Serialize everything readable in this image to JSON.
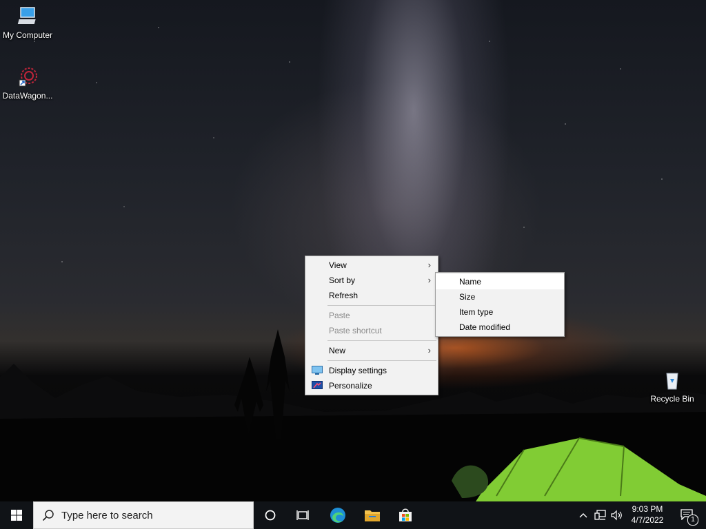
{
  "desktop": {
    "icons": [
      {
        "name": "My Computer",
        "icon": "computer-icon"
      },
      {
        "name": "DataWagon...",
        "icon": "datawagon-shortcut-icon"
      },
      {
        "name": "Recycle Bin",
        "icon": "recycle-bin-icon"
      }
    ]
  },
  "context_menu": {
    "items": [
      {
        "label": "View",
        "has_submenu": true
      },
      {
        "label": "Sort by",
        "has_submenu": true
      },
      {
        "label": "Refresh"
      },
      {
        "label": "Paste",
        "disabled": true
      },
      {
        "label": "Paste shortcut",
        "disabled": true
      },
      {
        "label": "New",
        "has_submenu": true
      },
      {
        "label": "Display settings",
        "icon": "display-settings-icon"
      },
      {
        "label": "Personalize",
        "icon": "personalize-icon"
      }
    ]
  },
  "sort_submenu": {
    "items": [
      {
        "label": "Name",
        "highlighted": true
      },
      {
        "label": "Size"
      },
      {
        "label": "Item type"
      },
      {
        "label": "Date modified"
      }
    ]
  },
  "taskbar": {
    "start_icon": "windows-logo-icon",
    "search_placeholder": "Type here to search",
    "apps": [
      "cortana-icon",
      "task-view-icon",
      "edge-icon",
      "file-explorer-icon",
      "store-icon"
    ],
    "tray_icons": [
      "chevron-up-icon",
      "network-icon",
      "volume-icon"
    ],
    "time": "9:03 PM",
    "date": "4/7/2022",
    "notification_count": "1"
  },
  "colors": {
    "taskbar": "#101317",
    "menu_bg": "#f2f2f2",
    "menu_hover": "#ffffff",
    "tent_green": "#8fe23a"
  }
}
